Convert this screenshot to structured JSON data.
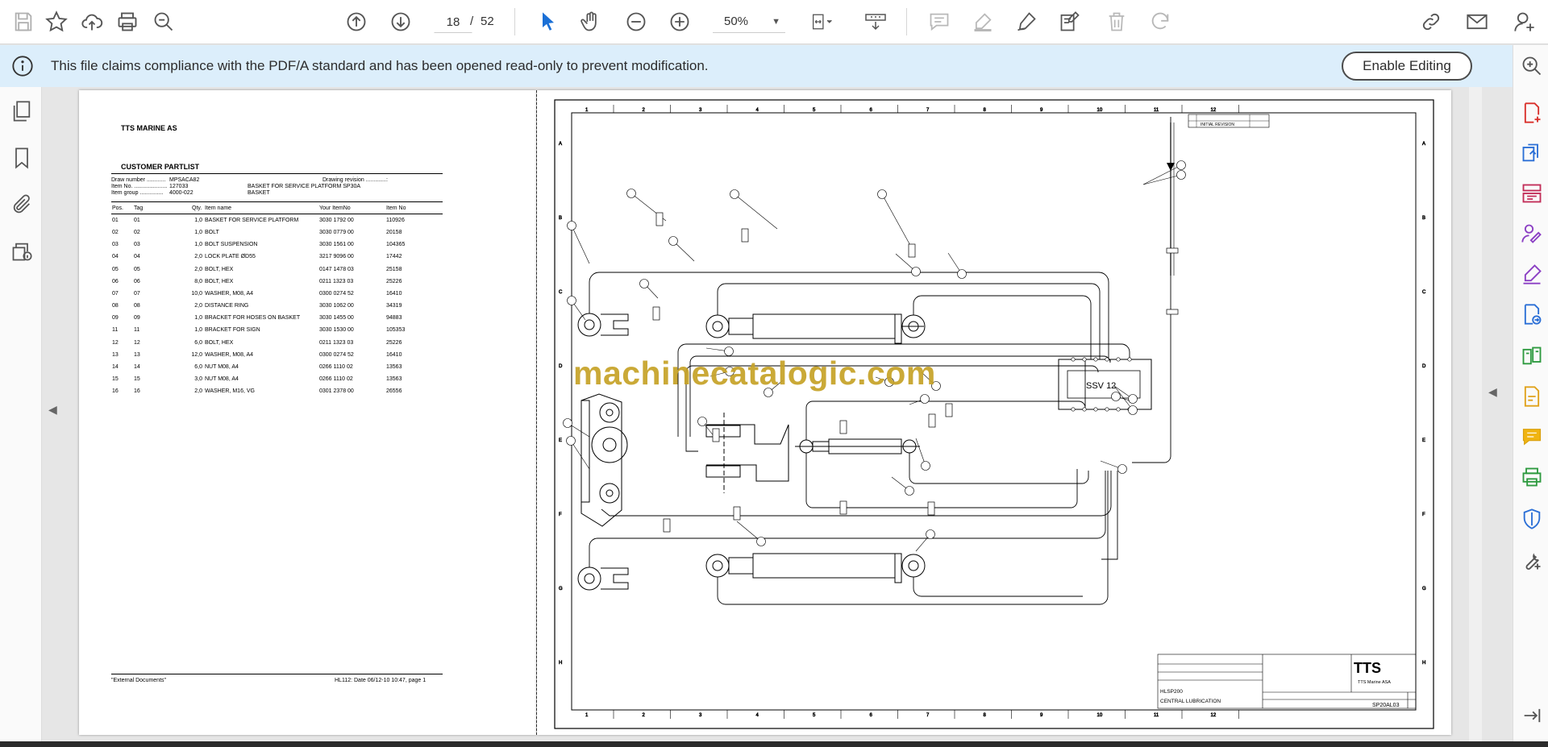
{
  "toolbar": {
    "page_current": "18",
    "page_separator": "/",
    "page_total": "52",
    "zoom_value": "50%"
  },
  "infobar": {
    "message": "This file claims compliance with the PDF/A standard and has been opened read-only to prevent modification.",
    "enable_button": "Enable Editing"
  },
  "partlist": {
    "company": "TTS MARINE AS",
    "title": "CUSTOMER PARTLIST",
    "draw_number_label": "Draw number ............",
    "draw_number": "MPSACA82",
    "drawing_revision_label": "Drawing revision .............:",
    "item_no_label": "Item No. .....................",
    "item_no": "127033",
    "item_desc": "BASKET FOR SERVICE PLATFORM SP30A",
    "item_group_label": "Item group ...............",
    "item_group": "4000-022",
    "item_group_desc": "BASKET",
    "columns": [
      "Pos.",
      "Tag",
      "Qty.",
      "Item name",
      "Your ItemNo",
      "Item No"
    ],
    "rows": [
      [
        "01",
        "01",
        "1,0",
        "BASKET FOR SERVICE PLATFORM",
        "3030 1792 00",
        "110926"
      ],
      [
        "02",
        "02",
        "1,0",
        "BOLT",
        "3030 0779 00",
        "20158"
      ],
      [
        "03",
        "03",
        "1,0",
        "BOLT SUSPENSION",
        "3030 1561 00",
        "104365"
      ],
      [
        "04",
        "04",
        "2,0",
        "LOCK PLATE ØD55",
        "3217 9096 00",
        "17442"
      ],
      [
        "05",
        "05",
        "2,0",
        "BOLT, HEX",
        "0147 1478 03",
        "25158"
      ],
      [
        "06",
        "06",
        "8,0",
        "BOLT, HEX",
        "0211 1323 03",
        "25226"
      ],
      [
        "07",
        "07",
        "10,0",
        "WASHER, M08, A4",
        "0300 0274 52",
        "16410"
      ],
      [
        "08",
        "08",
        "2,0",
        "DISTANCE RING",
        "3030 1062 00",
        "34319"
      ],
      [
        "09",
        "09",
        "1,0",
        "BRACKET FOR HOSES ON BASKET",
        "3030 1455 00",
        "94883"
      ],
      [
        "11",
        "11",
        "1,0",
        "BRACKET FOR SIGN",
        "3030 1530 00",
        "105353"
      ],
      [
        "12",
        "12",
        "6,0",
        "BOLT, HEX",
        "0211 1323 03",
        "25226"
      ],
      [
        "13",
        "13",
        "12,0",
        "WASHER, M08, A4",
        "0300 0274 52",
        "16410"
      ],
      [
        "14",
        "14",
        "6,0",
        "NUT M08, A4",
        "0266 1110 02",
        "13563"
      ],
      [
        "15",
        "15",
        "3,0",
        "NUT M08, A4",
        "0266 1110 02",
        "13563"
      ],
      [
        "16",
        "16",
        "2,0",
        "WASHER, M16, VG",
        "0301 2378 00",
        "26556"
      ]
    ],
    "footer_left": "\"External Documents\"",
    "footer_right": "HL112: Date 06/12-10 10:47, page 1"
  },
  "drawing": {
    "ssv_label": "SSV 12",
    "title_line1": "HLSP200",
    "title_line2": "CENTRAL LUBRICATION",
    "drawing_no": "SP20AL03",
    "brand": "TTS",
    "brand_sub": "TTS Marine ASA",
    "revision_text": "INITIAL REVISION",
    "grid_numbers": [
      "1",
      "2",
      "3",
      "4",
      "5",
      "6",
      "7",
      "8",
      "9",
      "10",
      "11",
      "12"
    ],
    "grid_letters": [
      "A",
      "B",
      "C",
      "D",
      "E",
      "F",
      "G",
      "H"
    ]
  },
  "watermark": "machinecatalogic.com"
}
